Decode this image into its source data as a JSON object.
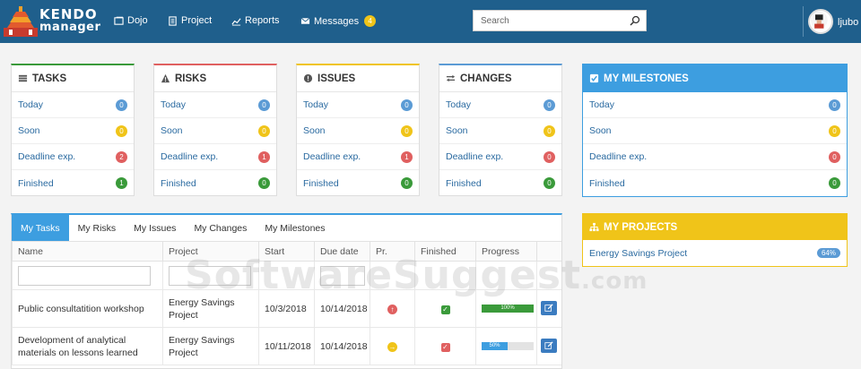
{
  "brand": {
    "line1": "KENDO",
    "line2": "manager"
  },
  "nav": [
    {
      "label": "Dojo",
      "icon": "window-icon"
    },
    {
      "label": "Project",
      "icon": "document-icon"
    },
    {
      "label": "Reports",
      "icon": "line-chart-icon"
    },
    {
      "label": "Messages",
      "icon": "envelope-icon",
      "badge": "4"
    }
  ],
  "search": {
    "placeholder": "Search"
  },
  "user": {
    "name": "ljubo"
  },
  "cards": {
    "tasks": {
      "title": "TASKS",
      "rows": [
        {
          "label": "Today",
          "count": "0",
          "color": "#5b9bd5"
        },
        {
          "label": "Soon",
          "count": "0",
          "color": "#f0c419"
        },
        {
          "label": "Deadline exp.",
          "count": "2",
          "color": "#e06060"
        },
        {
          "label": "Finished",
          "count": "1",
          "color": "#3a9a3a"
        }
      ],
      "accent": "#3a9a3a"
    },
    "risks": {
      "title": "RISKS",
      "rows": [
        {
          "label": "Today",
          "count": "0"
        },
        {
          "label": "Soon",
          "count": "0"
        },
        {
          "label": "Deadline exp.",
          "count": "1"
        },
        {
          "label": "Finished",
          "count": "0"
        }
      ],
      "accent": "#e06060"
    },
    "issues": {
      "title": "ISSUES",
      "rows": [
        {
          "label": "Today",
          "count": "0"
        },
        {
          "label": "Soon",
          "count": "0"
        },
        {
          "label": "Deadline exp.",
          "count": "1"
        },
        {
          "label": "Finished",
          "count": "0"
        }
      ],
      "accent": "#f0c419"
    },
    "changes": {
      "title": "CHANGES",
      "rows": [
        {
          "label": "Today",
          "count": "0"
        },
        {
          "label": "Soon",
          "count": "0"
        },
        {
          "label": "Deadline exp.",
          "count": "0"
        },
        {
          "label": "Finished",
          "count": "0"
        }
      ],
      "accent": "#5b9bd5"
    },
    "milestones": {
      "title": "MY MILESTONES",
      "rows": [
        {
          "label": "Today",
          "count": "0"
        },
        {
          "label": "Soon",
          "count": "0"
        },
        {
          "label": "Deadline exp.",
          "count": "0"
        },
        {
          "label": "Finished",
          "count": "0"
        }
      ]
    },
    "projects": {
      "title": "MY PROJECTS",
      "items": [
        {
          "label": "Energy Savings Project",
          "percent": "64%"
        }
      ]
    }
  },
  "tabs": [
    "My Tasks",
    "My Risks",
    "My Issues",
    "My Changes",
    "My Milestones"
  ],
  "table": {
    "columns": [
      "Name",
      "Project",
      "Start",
      "Due date",
      "Pr.",
      "Finished",
      "Progress",
      ""
    ],
    "rows": [
      {
        "name": "Public consultatition workshop",
        "project": "Energy Savings Project",
        "start": "10/3/2018",
        "due": "10/14/2018",
        "priority": "up",
        "finished_color": "#3a9a3a",
        "progress": 100,
        "progress_label": "100%",
        "progress_color": "#3a9a3a"
      },
      {
        "name": "Development of analytical materials on lessons learned",
        "project": "Energy Savings Project",
        "start": "10/11/2018",
        "due": "10/14/2018",
        "priority": "right",
        "finished_color": "#e06060",
        "progress": 50,
        "progress_label": "50%",
        "progress_color": "#3d9ee0"
      }
    ]
  },
  "watermark": {
    "main": "SoftwareSuggest",
    "suffix": ".com"
  }
}
